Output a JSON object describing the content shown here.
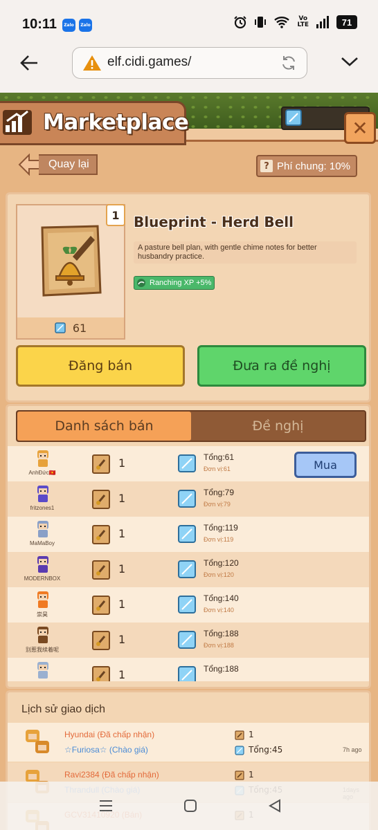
{
  "status": {
    "time": "10:11",
    "notif1": "Zalo",
    "notif2": "Zalo",
    "network": "Vo LTE",
    "battery": "71"
  },
  "browser": {
    "url": "elf.cidi.games/"
  },
  "market": {
    "title": "Marketplace",
    "back_label": "Quay lại",
    "fee_label": "Phí chung: 10%",
    "close_label": "✕"
  },
  "item": {
    "count": "1",
    "name": "Blueprint - Herd Bell",
    "description": "A pasture bell plan, with gentle chime notes for better husbandry practice.",
    "buff": "Ranching XP +5%",
    "price": "61",
    "sell_button": "Đăng bán",
    "offer_button": "Đưa ra đề nghị"
  },
  "tabs": {
    "active": "Danh sách bán",
    "inactive": "Đề nghị"
  },
  "listings": [
    {
      "user": "AnhĐức🇻🇳",
      "qty": "1",
      "total": "Tổng:61",
      "unit": "Đơn vị:61",
      "buy": "Mua"
    },
    {
      "user": "fritzones1",
      "qty": "1",
      "total": "Tổng:79",
      "unit": "Đơn vị:79"
    },
    {
      "user": "MaMaBoy",
      "qty": "1",
      "total": "Tổng:119",
      "unit": "Đơn vị:119"
    },
    {
      "user": "MODERNBOX",
      "qty": "1",
      "total": "Tổng:120",
      "unit": "Đơn vị:120"
    },
    {
      "user": "崇昊",
      "qty": "1",
      "total": "Tổng:140",
      "unit": "Đơn vị:140"
    },
    {
      "user": "别惹我续着呢",
      "qty": "1",
      "total": "Tổng:188",
      "unit": "Đơn vị:188"
    },
    {
      "user": "",
      "qty": "1",
      "total": "Tổng:188",
      "unit": ""
    }
  ],
  "history": {
    "title": "Lịch sử giao dịch",
    "rows": [
      {
        "seller": "Hyundai (Đã chấp nhận)",
        "buyer": "☆Furiosa☆ (Chào giá)",
        "qty": "1",
        "total": "Tổng:45",
        "ago": "7h ago"
      },
      {
        "seller": "Ravi2384 (Đã chấp nhận)",
        "buyer": "Thrandull (Chào giá)",
        "qty": "1",
        "total": "Tổng:45",
        "ago": "1days ago"
      },
      {
        "seller": "GCV31410920 (Bán)",
        "buyer": "",
        "qty": "1",
        "total": "",
        "ago": ""
      }
    ]
  },
  "colors": {
    "accent_orange": "#f5a157",
    "sell_yellow": "#fbd44a",
    "offer_green": "#5fd56b",
    "buy_blue": "#a6c7f7"
  }
}
